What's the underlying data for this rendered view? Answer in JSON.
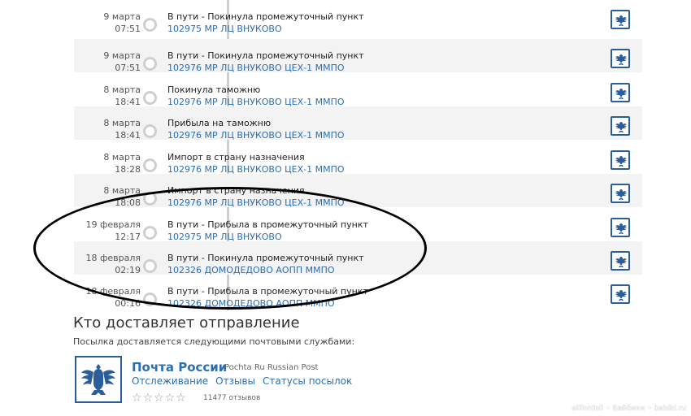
{
  "events": [
    {
      "date": "9 марта",
      "time": "07:51",
      "status": "В пути - Покинула промежуточный пункт",
      "place": "102975 МР ЛЦ ВНУКОВО"
    },
    {
      "date": "9 марта",
      "time": "07:51",
      "status": "В пути - Покинула промежуточный пункт",
      "place": "102976 МР ЛЦ ВНУКОВО ЦЕХ-1 ММПО"
    },
    {
      "date": "8 марта",
      "time": "18:41",
      "status": "Покинула таможню",
      "place": "102976 МР ЛЦ ВНУКОВО ЦЕХ-1 ММПО"
    },
    {
      "date": "8 марта",
      "time": "18:41",
      "status": "Прибыла на таможню",
      "place": "102976 МР ЛЦ ВНУКОВО ЦЕХ-1 ММПО"
    },
    {
      "date": "8 марта",
      "time": "18:28",
      "status": "Импорт в страну назначения",
      "place": "102976 МР ЛЦ ВНУКОВО ЦЕХ-1 ММПО"
    },
    {
      "date": "8 марта",
      "time": "18:08",
      "status": "Импорт в страну назначения",
      "place": "102976 МР ЛЦ ВНУКОВО ЦЕХ-1 ММПО"
    },
    {
      "date": "19 февраля",
      "time": "12:17",
      "status": "В пути - Прибыла в промежуточный пункт",
      "place": "102975 МР ЛЦ ВНУКОВО"
    },
    {
      "date": "18 февраля",
      "time": "02:19",
      "status": "В пути - Покинула промежуточный пункт",
      "place": "102326 ДОМОДЕДОВО АОПП ММПО"
    },
    {
      "date": "18 февраля",
      "time": "00:16",
      "status": "В пути - Прибыла в промежуточный пункт",
      "place": "102326 ДОМОДЕДОВО АОПП ММПО"
    }
  ],
  "delivery": {
    "heading": "Кто доставляет отправление",
    "subtitle": "Посылка доставляется следующими почтовыми службами:",
    "service_name": "Почта России",
    "service_alt": "Pochta Ru Russian Post",
    "links": [
      "Отслеживание",
      "Отзывы",
      "Статусы посылок"
    ],
    "stars": "☆☆☆☆☆",
    "reviews": "11477 отзывов"
  },
  "watermark": "allfordoll • Байбики • babiki.ru",
  "colors": {
    "link": "#2a6eb3",
    "post_blue": "#2b5d9a",
    "row_alt": "#f3f3f3"
  }
}
